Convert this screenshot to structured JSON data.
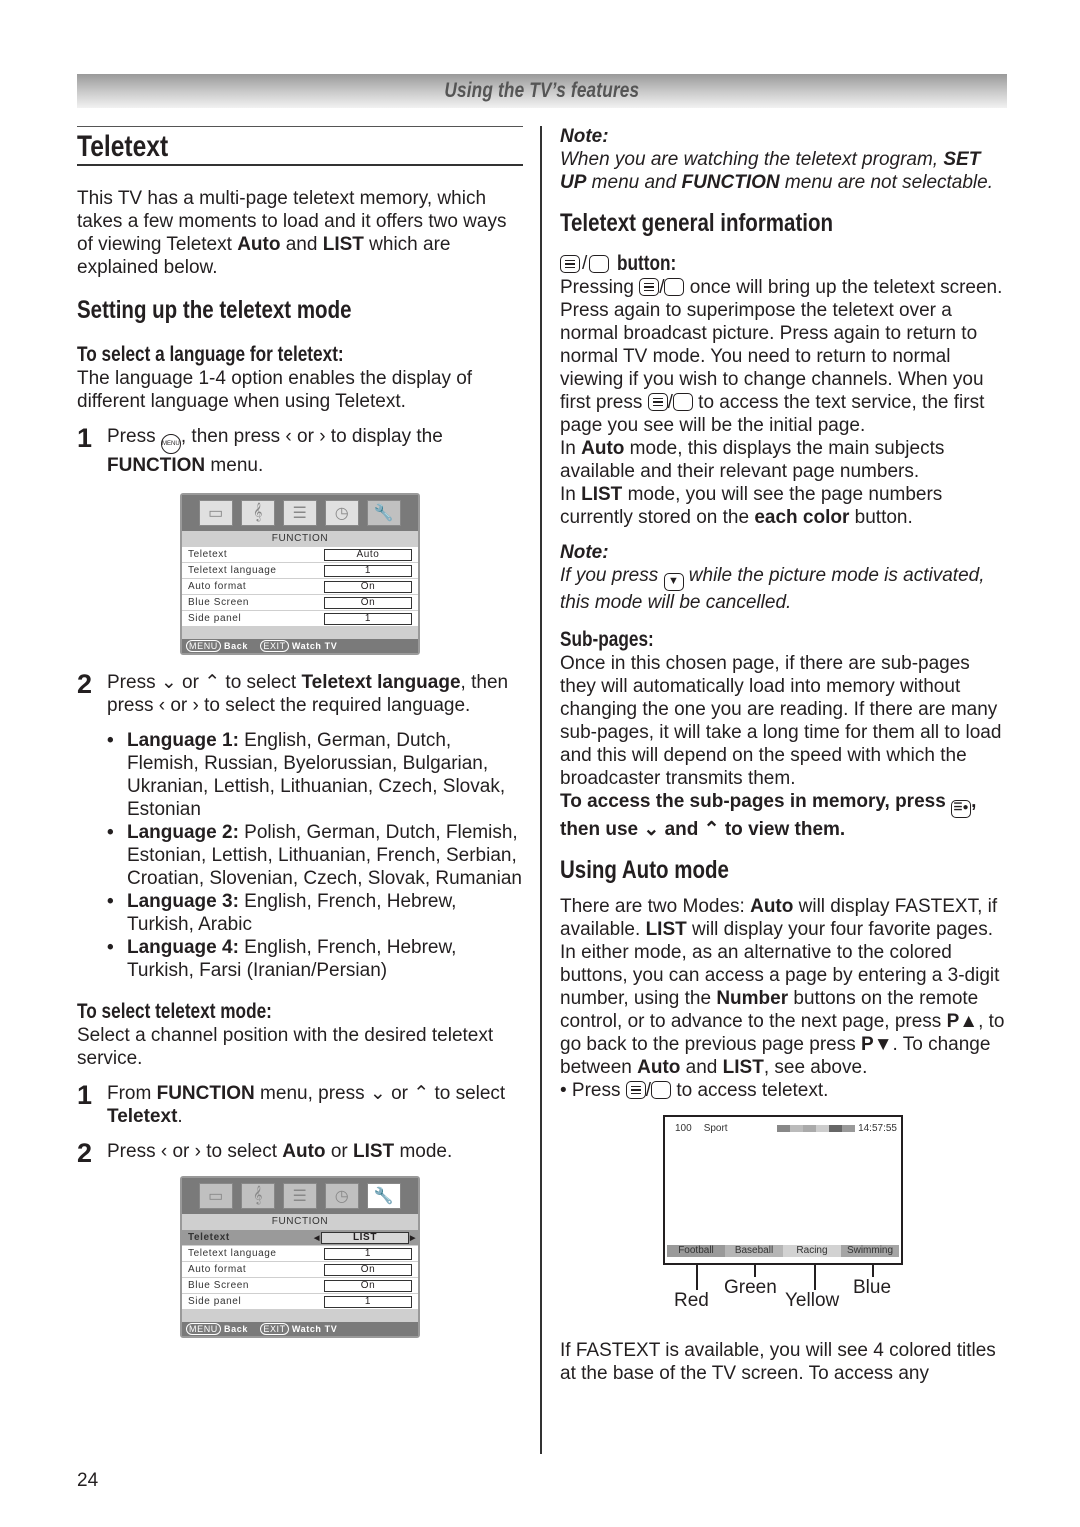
{
  "header": {
    "section_title": "Using the TV’s features"
  },
  "page_number": "24",
  "left": {
    "title": "Teletext",
    "intro": [
      "This TV has a multi-page teletext memory, which takes a few moments to load and it offers two ways of viewing Teletext ",
      "Auto",
      " and ",
      "LIST",
      " which are explained below."
    ],
    "setup_heading": "Setting up the teletext mode",
    "language_heading": "To select a language for teletext:",
    "language_intro": "The language 1-4 option enables the display of different language when using Teletext.",
    "step1": {
      "num": "1",
      "a": "Press ",
      "menu_key": "MENU",
      "b": ", then press ‹ or › to display the ",
      "bold": "FUNCTION",
      "c": " menu."
    },
    "osd1": {
      "icons": [
        "picture-icon",
        "sound-icon",
        "setup-icon",
        "timer-icon",
        "function-icon"
      ],
      "title": "FUNCTION",
      "rows": [
        {
          "label": "Teletext",
          "value": "Auto"
        },
        {
          "label": "Teletext language",
          "value": "1"
        },
        {
          "label": "Auto format",
          "value": "On"
        },
        {
          "label": "Blue Screen",
          "value": "On"
        },
        {
          "label": "Side panel",
          "value": "1"
        }
      ],
      "footer": {
        "menu_key": "MENU",
        "back": "Back",
        "exit_key": "EXIT",
        "watch": "Watch TV"
      }
    },
    "step2": {
      "num": "2",
      "a": "Press ⌄ or ⌃ to select ",
      "bold": "Teletext language",
      "b": ", then press ‹ or › to select the required language."
    },
    "languages": [
      {
        "label": "Language 1:",
        "text": " English, German, Dutch, Flemish, Russian, Byelorussian, Bulgarian, Ukranian, Lettish, Lithuanian, Czech, Slovak, Estonian"
      },
      {
        "label": "Language 2:",
        "text": " Polish, German, Dutch, Flemish, Estonian, Lettish, Lithuanian, French, Serbian, Croatian, Slovenian, Czech, Slovak, Rumanian"
      },
      {
        "label": "Language 3:",
        "text": " English, French, Hebrew, Turkish, Arabic"
      },
      {
        "label": "Language 4:",
        "text": " English, French, Hebrew, Turkish, Farsi (Iranian/Persian)"
      }
    ],
    "mode_heading": "To select teletext mode:",
    "mode_intro": "Select a channel position with the desired teletext service.",
    "mode_step1": {
      "num": "1",
      "a": "From ",
      "bold1": "FUNCTION",
      "b": " menu, press ⌄ or ⌃ to select ",
      "bold2": "Teletext",
      "c": "."
    },
    "mode_step2": {
      "num": "2",
      "a": "Press ‹ or › to select ",
      "bold1": "Auto",
      "b": " or ",
      "bold2": "LIST",
      "c": " mode."
    },
    "osd2": {
      "title": "FUNCTION",
      "rows": [
        {
          "label": "Teletext",
          "value": "LIST",
          "selected": true
        },
        {
          "label": "Teletext language",
          "value": "1"
        },
        {
          "label": "Auto format",
          "value": "On"
        },
        {
          "label": "Blue Screen",
          "value": "On"
        },
        {
          "label": "Side panel",
          "value": "1"
        }
      ],
      "footer": {
        "menu_key": "MENU",
        "back": "Back",
        "exit_key": "EXIT",
        "watch": "Watch TV"
      }
    }
  },
  "right": {
    "note1": {
      "label": "Note:",
      "a": "When you are watching the teletext program, ",
      "bold1": "SET UP",
      "b": " menu and ",
      "bold2": "FUNCTION",
      "c": " menu are not selectable."
    },
    "general_heading": "Teletext general information",
    "button_heading": "button:",
    "button_text_1": "Pressing ",
    "button_text_2": " once will bring up the teletext screen. Press again to superimpose the teletext over a normal broadcast picture. Press again to return to normal TV mode. You need to return to normal viewing if you wish to change channels. When you first press ",
    "button_text_3": " to access the text service, the first page you see will be the initial page.",
    "auto_text": [
      "In ",
      "Auto",
      " mode, this displays the main subjects available and their relevant page numbers."
    ],
    "list_text": [
      "In ",
      "LIST",
      " mode, you will see the page numbers currently stored on the ",
      "each color",
      " button."
    ],
    "note2": {
      "label": "Note:",
      "a": "If you press ",
      "b": " while the picture mode is activated, this mode will be cancelled."
    },
    "subpages_heading": "Sub-pages:",
    "subpages_text": "Once in this chosen page, if there are sub-pages they will automatically load into memory without changing the one you are reading. If there are many sub-pages, it will take a long time for them all to load and this will depend on the speed with which the broadcaster transmits them.",
    "subpages_bold_a": "To access the sub-pages in memory, press ",
    "subpages_bold_b": ", then use ⌄ and ⌃ to view them.",
    "auto_mode_heading": "Using Auto mode",
    "auto_mode_text": [
      "There are two Modes: ",
      "Auto",
      " will display FASTEXT, if available. ",
      "LIST",
      " will display your four favorite pages. In either mode, as an alternative to the colored buttons, you can access a page by entering a 3-digit number, using the ",
      "Number",
      " buttons on the remote control, or to advance to the next page, press ",
      "P▲",
      ", to go back to the previous page press ",
      "P▼",
      ". To change between ",
      "Auto",
      " and ",
      "LIST",
      ", see above."
    ],
    "bullet_a": "• Press ",
    "bullet_b": " to access teletext.",
    "teletext_screen": {
      "page": "100",
      "subject": "Sport",
      "time": "14:57:55",
      "titles": [
        "Football",
        "Baseball",
        "Racing",
        "Swimming"
      ],
      "colors": [
        "Red",
        "Green",
        "Yellow",
        "Blue"
      ]
    },
    "fastext_text": "If FASTEXT is available, you will see 4 colored titles at the base of the TV screen. To access any"
  }
}
